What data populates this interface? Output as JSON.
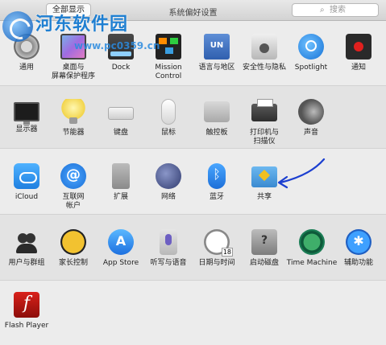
{
  "toolbar": {
    "show_all": "全部显示",
    "window_title": "系统偏好设置",
    "search_placeholder": "搜索"
  },
  "watermark": {
    "title": "河东软件园",
    "url": "www.pc0359.cn"
  },
  "rows": [
    [
      {
        "name": "general",
        "label": "通用",
        "icon": "general-icon"
      },
      {
        "name": "desktop-screensaver",
        "label": "桌面与\n屏幕保护程序",
        "icon": "desktop-icon"
      },
      {
        "name": "dock",
        "label": "Dock",
        "icon": "dock-icon"
      },
      {
        "name": "mission-control",
        "label": "Mission\nControl",
        "icon": "mission-control-icon"
      },
      {
        "name": "language-region",
        "label": "语言与地区",
        "icon": "un-flag-icon"
      },
      {
        "name": "security-privacy",
        "label": "安全性与隐私",
        "icon": "house-lock-icon"
      },
      {
        "name": "spotlight",
        "label": "Spotlight",
        "icon": "magnifier-icon"
      },
      {
        "name": "notifications",
        "label": "通知",
        "icon": "notification-icon"
      }
    ],
    [
      {
        "name": "displays",
        "label": "显示器",
        "icon": "monitor-icon"
      },
      {
        "name": "energy-saver",
        "label": "节能器",
        "icon": "lightbulb-icon"
      },
      {
        "name": "keyboard",
        "label": "键盘",
        "icon": "keyboard-icon"
      },
      {
        "name": "mouse",
        "label": "鼠标",
        "icon": "mouse-icon"
      },
      {
        "name": "trackpad",
        "label": "触控板",
        "icon": "trackpad-icon"
      },
      {
        "name": "printers-scanners",
        "label": "打印机与\n扫描仪",
        "icon": "printer-icon"
      },
      {
        "name": "sound",
        "label": "声音",
        "icon": "speaker-icon"
      }
    ],
    [
      {
        "name": "icloud",
        "label": "iCloud",
        "icon": "cloud-icon"
      },
      {
        "name": "internet-accounts",
        "label": "互联网\n帐户",
        "icon": "at-sign-icon"
      },
      {
        "name": "extensions",
        "label": "扩展",
        "icon": "puzzle-icon"
      },
      {
        "name": "network",
        "label": "网络",
        "icon": "globe-icon"
      },
      {
        "name": "bluetooth",
        "label": "蓝牙",
        "icon": "bluetooth-icon"
      },
      {
        "name": "sharing",
        "label": "共享",
        "icon": "sharing-folder-icon"
      }
    ],
    [
      {
        "name": "users-groups",
        "label": "用户与群组",
        "icon": "users-icon"
      },
      {
        "name": "parental-controls",
        "label": "家长控制",
        "icon": "parental-icon"
      },
      {
        "name": "app-store",
        "label": "App Store",
        "icon": "app-store-icon"
      },
      {
        "name": "dictation-speech",
        "label": "听写与语音",
        "icon": "microphone-icon"
      },
      {
        "name": "date-time",
        "label": "日期与时间",
        "icon": "clock-calendar-icon"
      },
      {
        "name": "startup-disk",
        "label": "启动磁盘",
        "icon": "disk-icon"
      },
      {
        "name": "time-machine",
        "label": "Time Machine",
        "icon": "time-machine-icon"
      },
      {
        "name": "accessibility",
        "label": "辅助功能",
        "icon": "accessibility-icon"
      }
    ],
    [
      {
        "name": "flash-player",
        "label": "Flash Player",
        "icon": "flash-icon"
      }
    ]
  ]
}
